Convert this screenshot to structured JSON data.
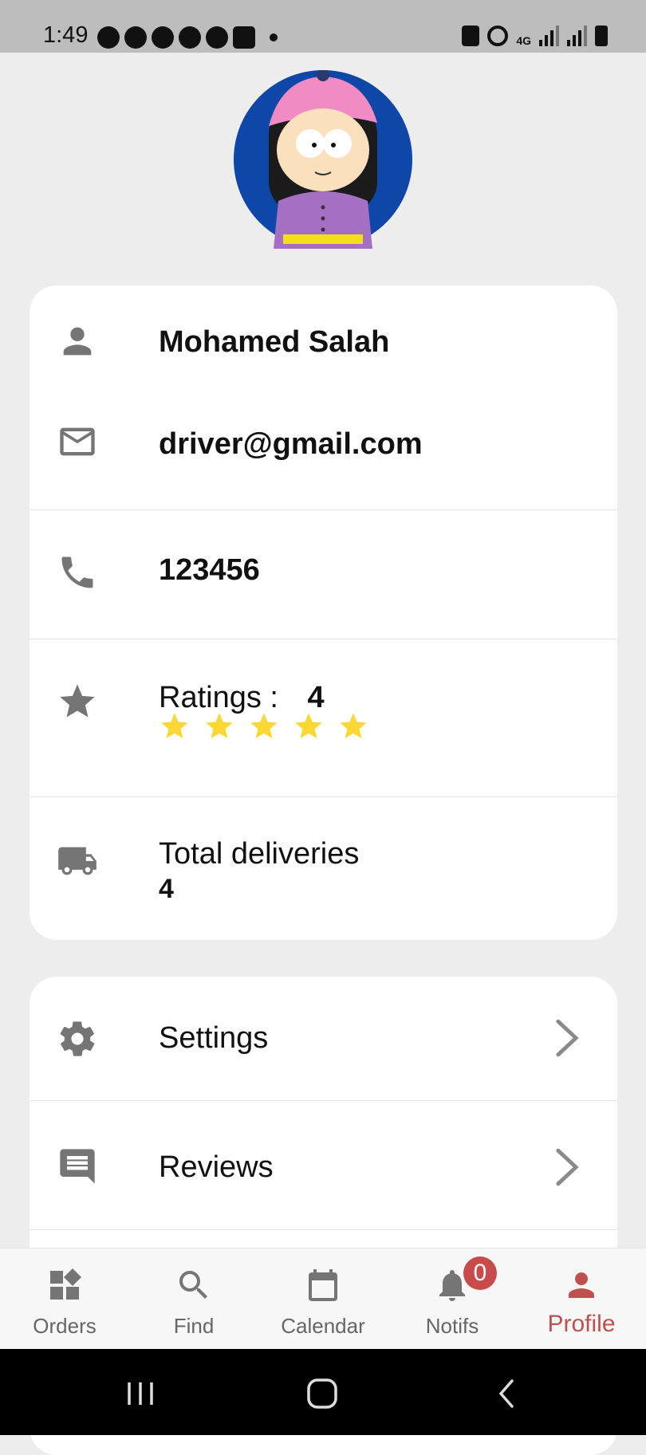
{
  "status_bar": {
    "time": "1:49",
    "network": "4G"
  },
  "profile": {
    "name": "Mohamed Salah",
    "email": "driver@gmail.com",
    "phone": "123456",
    "ratings_label": "Ratings :",
    "ratings_value": "4",
    "stars_shown": 5,
    "deliveries_label": "Total deliveries",
    "deliveries_value": "4"
  },
  "menu": {
    "settings_label": "Settings",
    "reviews_label": "Reviews"
  },
  "bottom_nav": {
    "items": [
      {
        "label": "Orders",
        "icon": "dashboard-icon"
      },
      {
        "label": "Find",
        "icon": "search-icon"
      },
      {
        "label": "Calendar",
        "icon": "calendar-icon"
      },
      {
        "label": "Notifs",
        "icon": "bell-icon"
      },
      {
        "label": "Profile",
        "icon": "person-icon"
      }
    ],
    "notif_badge": "0",
    "active": "Profile"
  },
  "colors": {
    "accent": "#c0504d",
    "badge": "#c94a4a",
    "star": "#fdd835",
    "icon_gray": "#757575"
  }
}
